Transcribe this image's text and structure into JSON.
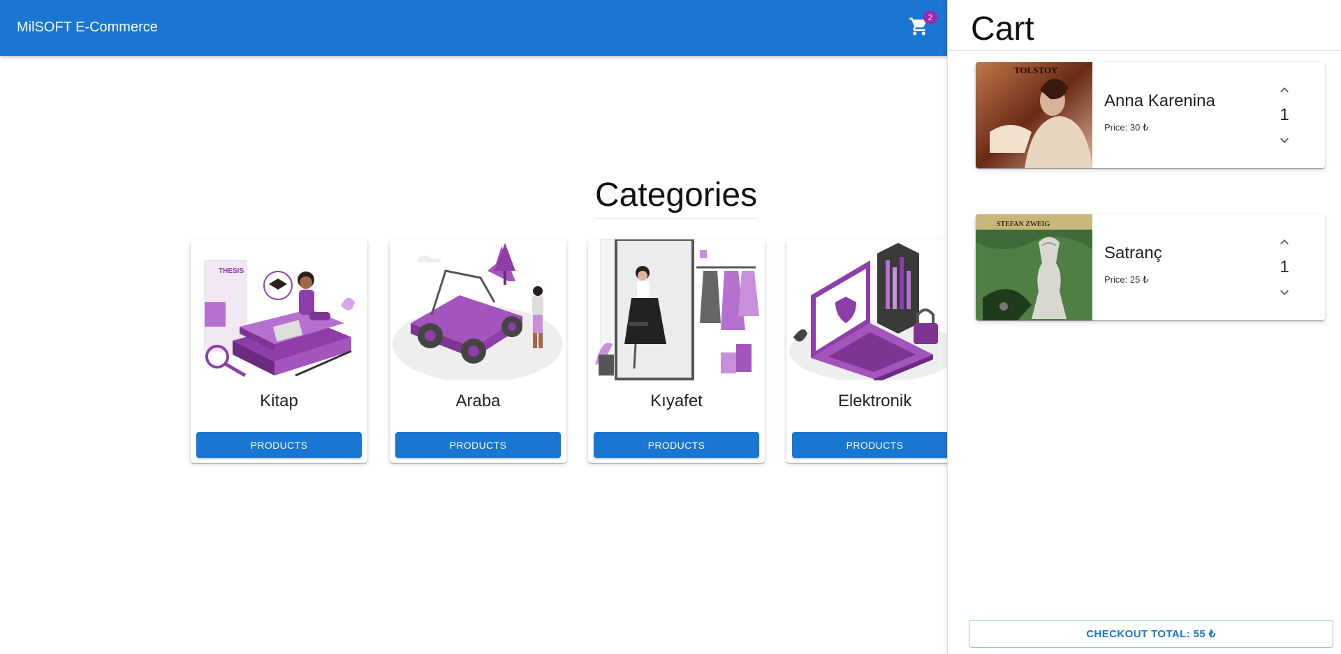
{
  "app": {
    "brand": "MilSOFT E-Commerce"
  },
  "appbar": {
    "cart_icon": "shopping-cart-icon",
    "cart_count": "2",
    "badge_color": "#9c27b0",
    "bar_color": "#1976d2"
  },
  "main": {
    "heading": "Categories",
    "categories": [
      {
        "name": "Kitap",
        "button": "PRODUCTS",
        "illustration": "books-study-illustration"
      },
      {
        "name": "Araba",
        "button": "PRODUCTS",
        "illustration": "jeep-car-illustration"
      },
      {
        "name": "Kıyafet",
        "button": "PRODUCTS",
        "illustration": "clothing-shopping-illustration"
      },
      {
        "name": "Elektronik",
        "button": "PRODUCTS",
        "illustration": "laptop-electronics-illustration"
      }
    ]
  },
  "cart": {
    "title": "Cart",
    "items": [
      {
        "name": "Anna Karenina",
        "price": "Price: 30 ₺",
        "quantity": "1",
        "cover_text": "TOLSTOY"
      },
      {
        "name": "Satranç",
        "price": "Price: 25 ₺",
        "quantity": "1",
        "cover_text": "STEFAN ZWEIG"
      }
    ],
    "checkout": "CHECKOUT TOTAL: 55 ₺"
  },
  "colors": {
    "primary": "#1976d2",
    "accent_purple": "#9c4fb8"
  }
}
